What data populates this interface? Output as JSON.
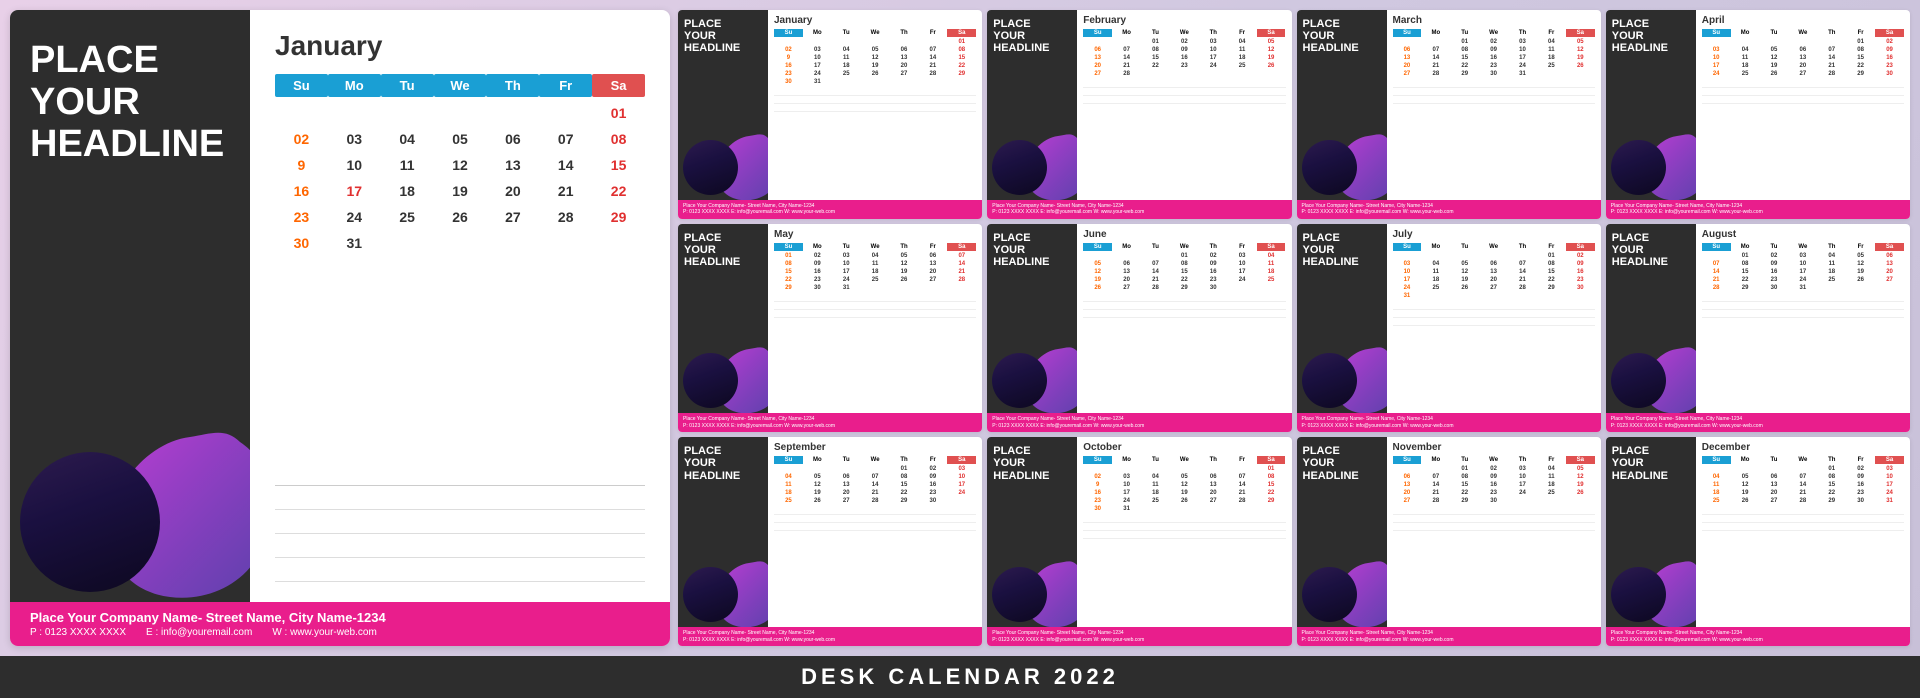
{
  "bottom_title": "DESK CALENDAR  2022",
  "large_calendar": {
    "headline": "PLACE\nYOUR\nHEADLINE",
    "month": "January",
    "days_header": [
      "Su",
      "Mo",
      "Tu",
      "We",
      "Th",
      "Fr",
      "Sa"
    ],
    "rows": [
      [
        "",
        "",
        "",
        "",
        "",
        "",
        "01"
      ],
      [
        "02",
        "03",
        "04",
        "05",
        "06",
        "07",
        "08"
      ],
      [
        "9",
        "10",
        "11",
        "12",
        "13",
        "14",
        "15"
      ],
      [
        "16",
        "17",
        "18",
        "19",
        "20",
        "21",
        "22"
      ],
      [
        "23",
        "24",
        "25",
        "26",
        "27",
        "28",
        "29"
      ],
      [
        "30",
        "31",
        "",
        "",
        "",
        "",
        ""
      ]
    ],
    "footer": {
      "company": "Place Your Company Name- Street Name, City Name-1234",
      "phone": "P : 0123 XXXX XXXX",
      "email": "E : info@youremail.com",
      "web": "W : www.your-web.com"
    }
  },
  "mini_calendars": [
    {
      "month": "January",
      "headline": "PLACE\nYOUR\nHEADLINE",
      "rows": [
        [
          "",
          "",
          "",
          "",
          "",
          "",
          "01"
        ],
        [
          "02",
          "03",
          "04",
          "05",
          "06",
          "07",
          "08"
        ],
        [
          "9",
          "10",
          "11",
          "12",
          "13",
          "14",
          "15"
        ],
        [
          "16",
          "17",
          "18",
          "19",
          "20",
          "21",
          "22"
        ],
        [
          "23",
          "24",
          "25",
          "26",
          "27",
          "28",
          "29"
        ],
        [
          "30",
          "31",
          "",
          "",
          "",
          "",
          ""
        ]
      ]
    },
    {
      "month": "February",
      "headline": "PLACE\nYOUR\nHEADLINE",
      "rows": [
        [
          "",
          "",
          "01",
          "02",
          "03",
          "04",
          "05"
        ],
        [
          "06",
          "07",
          "08",
          "09",
          "10",
          "11",
          "12"
        ],
        [
          "13",
          "14",
          "15",
          "16",
          "17",
          "18",
          "19"
        ],
        [
          "20",
          "21",
          "22",
          "23",
          "24",
          "25",
          "26"
        ],
        [
          "27",
          "28",
          "",
          "",
          "",
          "",
          ""
        ]
      ]
    },
    {
      "month": "March",
      "headline": "PLACE\nYOUR\nHEADLINE",
      "rows": [
        [
          "",
          "",
          "01",
          "02",
          "03",
          "04",
          "05"
        ],
        [
          "06",
          "07",
          "08",
          "09",
          "10",
          "11",
          "12"
        ],
        [
          "13",
          "14",
          "15",
          "16",
          "17",
          "18",
          "19"
        ],
        [
          "20",
          "21",
          "22",
          "23",
          "24",
          "25",
          "26"
        ],
        [
          "27",
          "28",
          "29",
          "30",
          "31",
          "",
          ""
        ]
      ]
    },
    {
      "month": "April",
      "headline": "PLACE\nYOUR\nHEADLINE",
      "rows": [
        [
          "",
          "",
          "",
          "",
          "",
          "01",
          "02"
        ],
        [
          "03",
          "04",
          "05",
          "06",
          "07",
          "08",
          "09"
        ],
        [
          "10",
          "11",
          "12",
          "13",
          "14",
          "15",
          "16"
        ],
        [
          "17",
          "18",
          "19",
          "20",
          "21",
          "22",
          "23"
        ],
        [
          "24",
          "25",
          "26",
          "27",
          "28",
          "29",
          "30"
        ]
      ]
    },
    {
      "month": "May",
      "headline": "PLACE\nYOUR\nHEADLINE",
      "rows": [
        [
          "01",
          "02",
          "03",
          "04",
          "05",
          "06",
          "07"
        ],
        [
          "08",
          "09",
          "10",
          "11",
          "12",
          "13",
          "14"
        ],
        [
          "15",
          "16",
          "17",
          "18",
          "19",
          "20",
          "21"
        ],
        [
          "22",
          "23",
          "24",
          "25",
          "26",
          "27",
          "28"
        ],
        [
          "29",
          "30",
          "31",
          "",
          "",
          "",
          ""
        ]
      ]
    },
    {
      "month": "June",
      "headline": "PLACE\nYOUR\nHEADLINE",
      "rows": [
        [
          "",
          "",
          "",
          "01",
          "02",
          "03",
          "04"
        ],
        [
          "05",
          "06",
          "07",
          "08",
          "09",
          "10",
          "11"
        ],
        [
          "12",
          "13",
          "14",
          "15",
          "16",
          "17",
          "18"
        ],
        [
          "19",
          "20",
          "21",
          "22",
          "23",
          "24",
          "25"
        ],
        [
          "26",
          "27",
          "28",
          "29",
          "30",
          "",
          ""
        ]
      ]
    },
    {
      "month": "July",
      "headline": "PLACE\nYOUR\nHEADLINE",
      "rows": [
        [
          "",
          "",
          "",
          "",
          "",
          "01",
          "02"
        ],
        [
          "03",
          "04",
          "05",
          "06",
          "07",
          "08",
          "09"
        ],
        [
          "10",
          "11",
          "12",
          "13",
          "14",
          "15",
          "16"
        ],
        [
          "17",
          "18",
          "19",
          "20",
          "21",
          "22",
          "23"
        ],
        [
          "24",
          "25",
          "26",
          "27",
          "28",
          "29",
          "30"
        ],
        [
          "31",
          "",
          "",
          "",
          "",
          "",
          ""
        ]
      ]
    },
    {
      "month": "August",
      "headline": "PLACE\nYOUR\nHEADLINE",
      "rows": [
        [
          "",
          "01",
          "02",
          "03",
          "04",
          "05",
          "06"
        ],
        [
          "07",
          "08",
          "09",
          "10",
          "11",
          "12",
          "13"
        ],
        [
          "14",
          "15",
          "16",
          "17",
          "18",
          "19",
          "20"
        ],
        [
          "21",
          "22",
          "23",
          "24",
          "25",
          "26",
          "27"
        ],
        [
          "28",
          "29",
          "30",
          "31",
          "",
          "",
          ""
        ]
      ]
    },
    {
      "month": "September",
      "headline": "PLACE\nYOUR\nHEADLINE",
      "rows": [
        [
          "",
          "",
          "",
          "",
          "01",
          "02",
          "03"
        ],
        [
          "04",
          "05",
          "06",
          "07",
          "08",
          "09",
          "10"
        ],
        [
          "11",
          "12",
          "13",
          "14",
          "15",
          "16",
          "17"
        ],
        [
          "18",
          "19",
          "20",
          "21",
          "22",
          "23",
          "24"
        ],
        [
          "25",
          "26",
          "27",
          "28",
          "29",
          "30",
          ""
        ]
      ]
    },
    {
      "month": "October",
      "headline": "PLACE\nYOUR\nHEADLINE",
      "rows": [
        [
          "",
          "",
          "",
          "",
          "",
          "",
          "01"
        ],
        [
          "02",
          "03",
          "04",
          "05",
          "06",
          "07",
          "08"
        ],
        [
          "9",
          "10",
          "11",
          "12",
          "13",
          "14",
          "15"
        ],
        [
          "16",
          "17",
          "18",
          "19",
          "20",
          "21",
          "22"
        ],
        [
          "23",
          "24",
          "25",
          "26",
          "27",
          "28",
          "29"
        ],
        [
          "30",
          "31",
          "",
          "",
          "",
          "",
          ""
        ]
      ]
    },
    {
      "month": "November",
      "headline": "PLACE\nYOUR\nHEADLINE",
      "rows": [
        [
          "",
          "",
          "01",
          "02",
          "03",
          "04",
          "05"
        ],
        [
          "06",
          "07",
          "08",
          "09",
          "10",
          "11",
          "12"
        ],
        [
          "13",
          "14",
          "15",
          "16",
          "17",
          "18",
          "19"
        ],
        [
          "20",
          "21",
          "22",
          "23",
          "24",
          "25",
          "26"
        ],
        [
          "27",
          "28",
          "29",
          "30",
          "",
          "",
          ""
        ]
      ]
    },
    {
      "month": "December",
      "headline": "PLACE\nYOUR\nHEADLINE",
      "rows": [
        [
          "",
          "",
          "",
          "",
          "01",
          "02",
          "03"
        ],
        [
          "04",
          "05",
          "06",
          "07",
          "08",
          "09",
          "10"
        ],
        [
          "11",
          "12",
          "13",
          "14",
          "15",
          "16",
          "17"
        ],
        [
          "18",
          "19",
          "20",
          "21",
          "22",
          "23",
          "24"
        ],
        [
          "25",
          "26",
          "27",
          "28",
          "29",
          "30",
          "31"
        ]
      ]
    }
  ],
  "days_header": [
    "Su",
    "Mo",
    "Tu",
    "We",
    "Th",
    "Fr",
    "Sa"
  ],
  "footer_template": "Place Your Company Name- Street Name, City Name-1234"
}
